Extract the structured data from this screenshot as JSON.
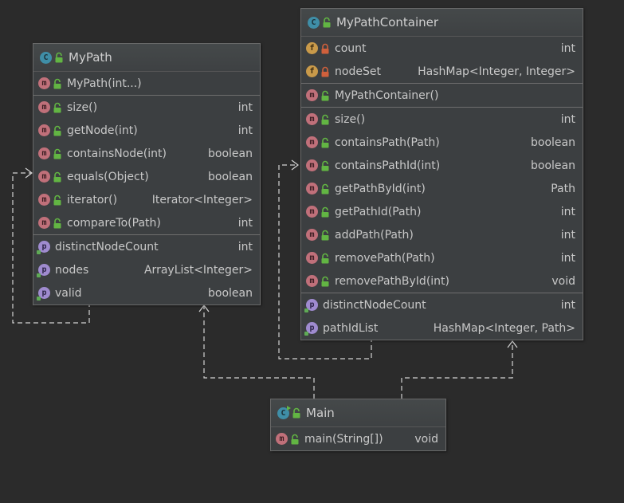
{
  "diagram": {
    "classes": {
      "mypath": {
        "name": "MyPath",
        "icon": "class-icon",
        "constructors": [
          {
            "name": "MyPath(int...)",
            "type": ""
          }
        ],
        "methods": [
          {
            "name": "size()",
            "type": "int"
          },
          {
            "name": "getNode(int)",
            "type": "int"
          },
          {
            "name": "containsNode(int)",
            "type": "boolean"
          },
          {
            "name": "equals(Object)",
            "type": "boolean"
          },
          {
            "name": "iterator()",
            "type": "Iterator<Integer>"
          },
          {
            "name": "compareTo(Path)",
            "type": "int"
          }
        ],
        "properties": [
          {
            "name": "distinctNodeCount",
            "type": "int"
          },
          {
            "name": "nodes",
            "type": "ArrayList<Integer>"
          },
          {
            "name": "valid",
            "type": "boolean"
          }
        ]
      },
      "mypathcontainer": {
        "name": "MyPathContainer",
        "icon": "class-icon",
        "fields": [
          {
            "name": "count",
            "type": "int"
          },
          {
            "name": "nodeSet",
            "type": "HashMap<Integer, Integer>"
          }
        ],
        "constructors": [
          {
            "name": "MyPathContainer()",
            "type": ""
          }
        ],
        "methods": [
          {
            "name": "size()",
            "type": "int"
          },
          {
            "name": "containsPath(Path)",
            "type": "boolean"
          },
          {
            "name": "containsPathId(int)",
            "type": "boolean"
          },
          {
            "name": "getPathById(int)",
            "type": "Path"
          },
          {
            "name": "getPathId(Path)",
            "type": "int"
          },
          {
            "name": "addPath(Path)",
            "type": "int"
          },
          {
            "name": "removePath(Path)",
            "type": "int"
          },
          {
            "name": "removePathById(int)",
            "type": "void"
          }
        ],
        "properties": [
          {
            "name": "distinctNodeCount",
            "type": "int"
          },
          {
            "name": "pathIdList",
            "type": "HashMap<Integer, Path>"
          }
        ]
      },
      "main": {
        "name": "Main",
        "icon": "main-class-icon",
        "methods": [
          {
            "name": "main(String[])",
            "type": "void"
          }
        ]
      }
    },
    "relations": [
      {
        "from": "MyPath",
        "to": "MyPath",
        "kind": "dependency"
      },
      {
        "from": "MyPathContainer",
        "to": "MyPathContainer",
        "kind": "dependency"
      },
      {
        "from": "Main",
        "to": "MyPath",
        "kind": "dependency"
      },
      {
        "from": "Main",
        "to": "MyPathContainer",
        "kind": "dependency"
      }
    ],
    "colors": {
      "background": "#2b2b2b",
      "node": "#3c3f41",
      "class_badge": "#3f8ea7",
      "method_badge": "#c0707a",
      "field_badge": "#c99a4a",
      "property_badge": "#9f8bcf",
      "public_lock": "#62b543",
      "private_lock": "#d0603c",
      "edge": "#d4d4d4"
    }
  }
}
